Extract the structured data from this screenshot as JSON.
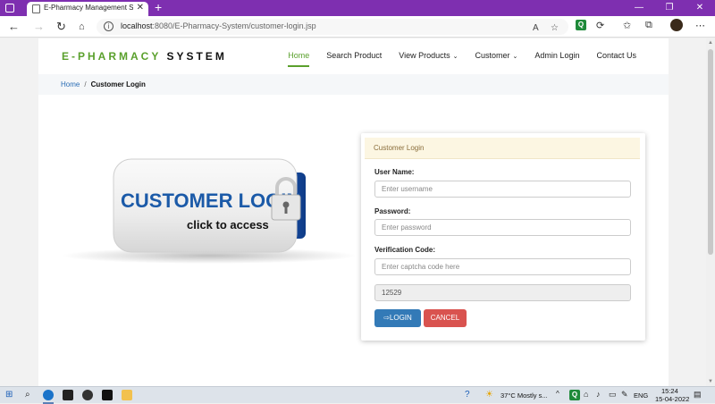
{
  "browser": {
    "tab_title": "E-Pharmacy Management System",
    "tab_close": "✕",
    "new_tab": "+",
    "url_host": "localhost",
    "url_rest": ":8080/E-Pharmacy-System/customer-login.jsp",
    "window_minimize": "—",
    "window_maximize": "❐",
    "window_close": "✕"
  },
  "header": {
    "brand_prefix": "E-PHARMACY",
    "brand_suffix": "SYSTEM"
  },
  "nav": {
    "items": [
      {
        "label": "Home"
      },
      {
        "label": "Search Product"
      },
      {
        "label": "View Products"
      },
      {
        "label": "Customer"
      },
      {
        "label": "Admin Login"
      },
      {
        "label": "Contact Us"
      }
    ]
  },
  "breadcrumb": {
    "home": "Home",
    "separator": "/",
    "current": "Customer Login"
  },
  "graphic": {
    "title": "CUSTOMER LOGIN",
    "subtitle": "click to access"
  },
  "login_form": {
    "heading": "Customer Login",
    "username_label": "User Name:",
    "username_placeholder": "Enter username",
    "password_label": "Password:",
    "password_placeholder": "Enter password",
    "captcha_label": "Verification Code:",
    "captcha_placeholder": "Enter captcha code here",
    "captcha_code": "12529",
    "login_button": "LOGIN",
    "cancel_button": "CANCEL"
  },
  "taskbar": {
    "weather": "37°C  Mostly s...",
    "language": "ENG",
    "time": "15:24",
    "date": "15-04-2022"
  },
  "colors": {
    "accent_green": "#5aa02c",
    "link_blue": "#2a6db5",
    "login_button": "#337ab7",
    "cancel_button": "#d9534f",
    "tabbar_purple": "#7e2fb0"
  }
}
